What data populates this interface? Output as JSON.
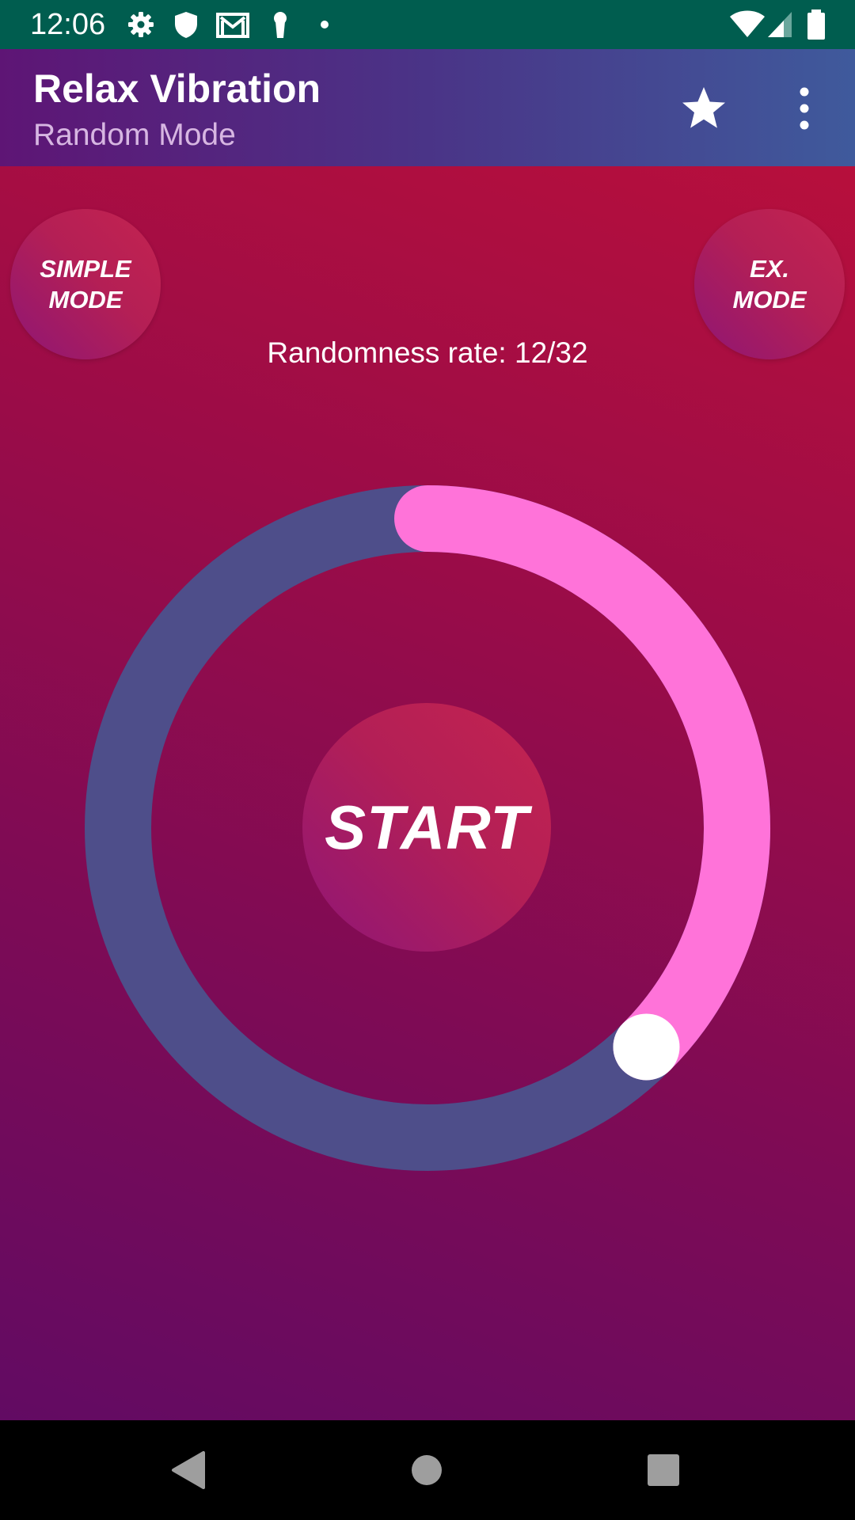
{
  "status_bar": {
    "time": "12:06",
    "left_icons": [
      "gear-icon",
      "shield-icon",
      "gmail-icon",
      "keyhole-icon",
      "dot-icon"
    ],
    "right_icons": [
      "wifi-icon",
      "signal-icon",
      "battery-icon"
    ],
    "background_color": "#005d4f"
  },
  "app_bar": {
    "title": "Relax Vibration",
    "subtitle": "Random Mode",
    "actions": [
      "star-icon",
      "more-vert-icon"
    ]
  },
  "main": {
    "simple_mode_label": "SIMPLE\nMODE",
    "ex_mode_label": "EX.\nMODE",
    "randomness_text": "Randomness rate: 12/32",
    "randomness": {
      "value": 12,
      "max": 32
    },
    "start_label": "START",
    "colors": {
      "track": "#4e4e8a",
      "progress": "#ff73d9",
      "thumb": "#ffffff"
    }
  },
  "nav_bar": {
    "buttons": [
      "back-icon",
      "home-icon",
      "recents-icon"
    ]
  }
}
